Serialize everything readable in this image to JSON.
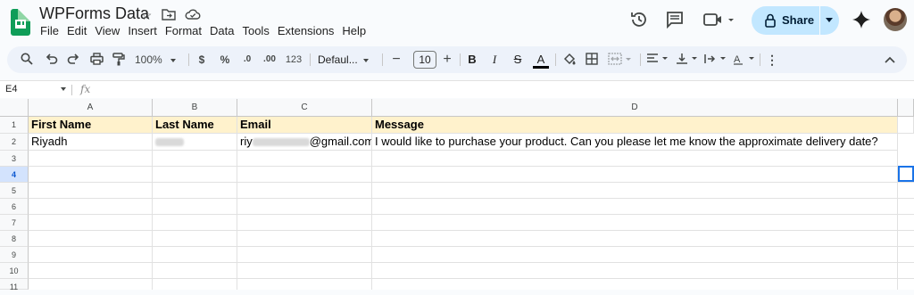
{
  "title_bar": {
    "doc_title": "WPForms Data",
    "menu": [
      "File",
      "Edit",
      "View",
      "Insert",
      "Format",
      "Data",
      "Tools",
      "Extensions",
      "Help"
    ],
    "share_label": "Share"
  },
  "toolbar": {
    "zoom": "100%",
    "currency": "$",
    "percent": "%",
    "decrease_decimal": ".0",
    "increase_decimal": ".00",
    "number_format": "123",
    "font_family": "Defaul...",
    "font_size": "10",
    "bold": "B",
    "italic": "I",
    "strikethrough": "S",
    "text_color": "A"
  },
  "formula_bar": {
    "name_box": "E4",
    "fx_label": "fx"
  },
  "sheet": {
    "columns": [
      "A",
      "B",
      "C",
      "D"
    ],
    "rows": [
      "1",
      "2",
      "3",
      "4",
      "5",
      "6",
      "7",
      "8",
      "9",
      "10",
      "11"
    ],
    "header_row": [
      "First Name",
      "Last Name",
      "Email",
      "Message"
    ],
    "data_row": {
      "first_name": "Riyadh",
      "email_prefix": "riy",
      "email_suffix": "@gmail.com",
      "message": "I would like to purchase your product. Can you please let me know the approximate delivery date?"
    },
    "selected_row": "4"
  },
  "colors": {
    "header_fill": "#fff2cc",
    "selection": "#1a73e8",
    "share_button": "#c2e7ff",
    "app_green": "#0f9d58"
  }
}
